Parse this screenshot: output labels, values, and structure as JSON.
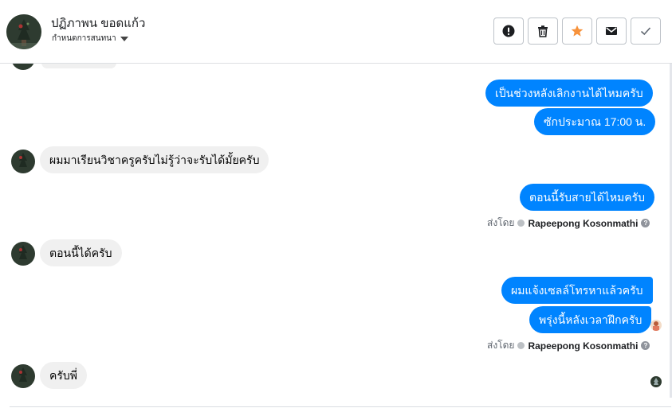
{
  "header": {
    "contact_name": "ปฏิภาพน ขอดแก้ว",
    "subtitle": "กำหนดการสนทนา",
    "actions": [
      {
        "icon": "exclamation-circle-icon"
      },
      {
        "icon": "trash-icon"
      },
      {
        "icon": "star-icon",
        "color": "#f7923b"
      },
      {
        "icon": "envelope-icon"
      },
      {
        "icon": "checkmark-icon"
      }
    ]
  },
  "messages": [
    {
      "direction": "outgoing",
      "text": "เป็นช่วงหลังเลิกงานได้ไหมครับ"
    },
    {
      "direction": "outgoing",
      "text": "ซักประมาณ 17:00 น."
    },
    {
      "direction": "incoming",
      "text": "ผมมาเรียนวิชาครูครับไม่รู้ว่าจะรับได้มั้ยครับ"
    },
    {
      "direction": "outgoing",
      "text": "ตอนนี้รับสายได้ไหมครับ"
    },
    {
      "direction": "incoming",
      "text": "ตอนนี้ได้ครับ"
    },
    {
      "direction": "outgoing",
      "text": "ผมแจ้งเซลล์โทรหาแล้วครับ"
    },
    {
      "direction": "outgoing",
      "text": "พรุ่งนี้หลังเวลาฝึกครับ"
    },
    {
      "direction": "incoming",
      "text": "ครับพี่"
    }
  ],
  "sent_by": {
    "prefix": "ส่งโดย",
    "name": "Rapeepong Kosonmathi",
    "help": "?"
  },
  "colors": {
    "outgoing_bubble": "#0084ff",
    "incoming_bubble": "#f0f0f0",
    "star": "#f7923b"
  }
}
